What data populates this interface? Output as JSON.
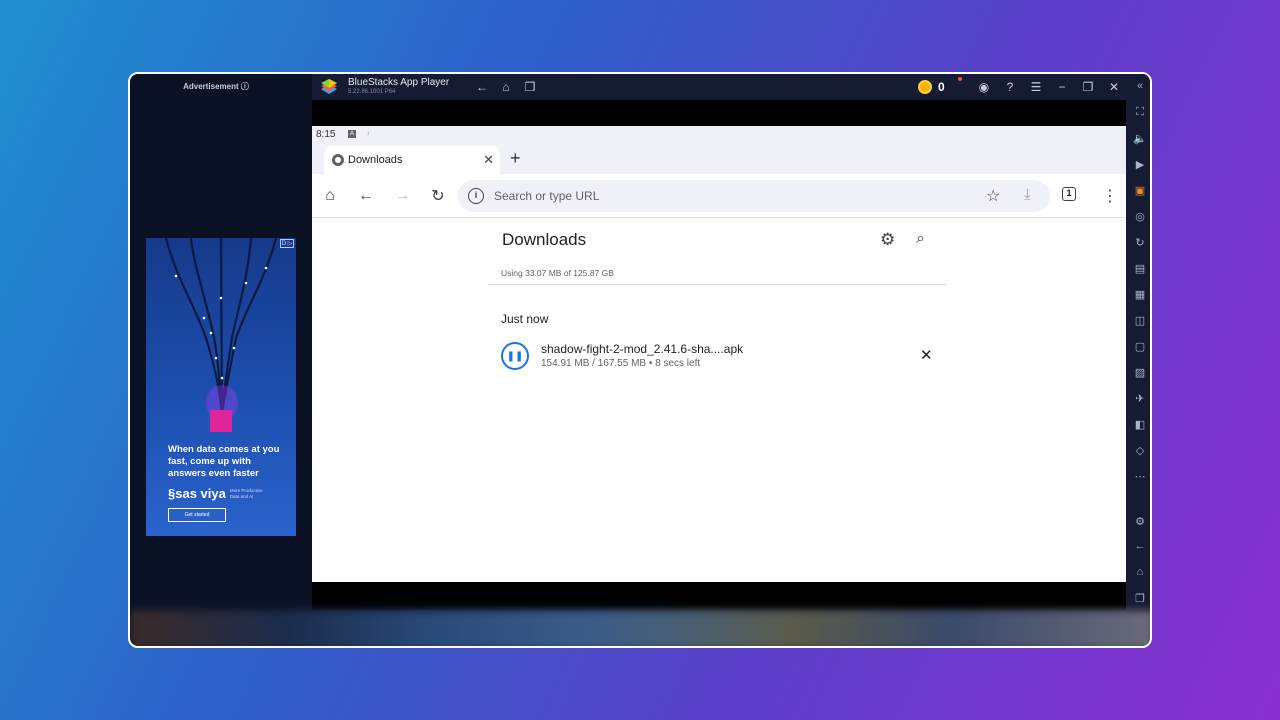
{
  "ad": {
    "label": "Advertisement ⓘ",
    "badge": "D ▷",
    "headline": "When data comes at you fast, come up with answers even faster",
    "brand": "§sas viya",
    "brand_sub": "More Productive Data and AI",
    "cta": "Get started"
  },
  "titlebar": {
    "app_name": "BlueStacks App Player",
    "version": "5.22.86.1001  P64",
    "coins": "0"
  },
  "statusbar": {
    "time": "8:15"
  },
  "tab": {
    "title": "Downloads",
    "close": "✕",
    "new": "+"
  },
  "toolbar": {
    "url_placeholder": "Search or type URL",
    "tab_count": "1"
  },
  "downloads": {
    "title": "Downloads",
    "usage": "Using 33.07 MB of 125.87 GB",
    "section": "Just now",
    "item": {
      "name": "shadow-fight-2-mod_2.41.6-sha....apk",
      "meta": "154.91 MB / 167.55 MB • 8 secs left",
      "progress": 0.9246
    }
  },
  "colors": {
    "accent": "#1a73e8",
    "sidebar": "#141b33"
  }
}
